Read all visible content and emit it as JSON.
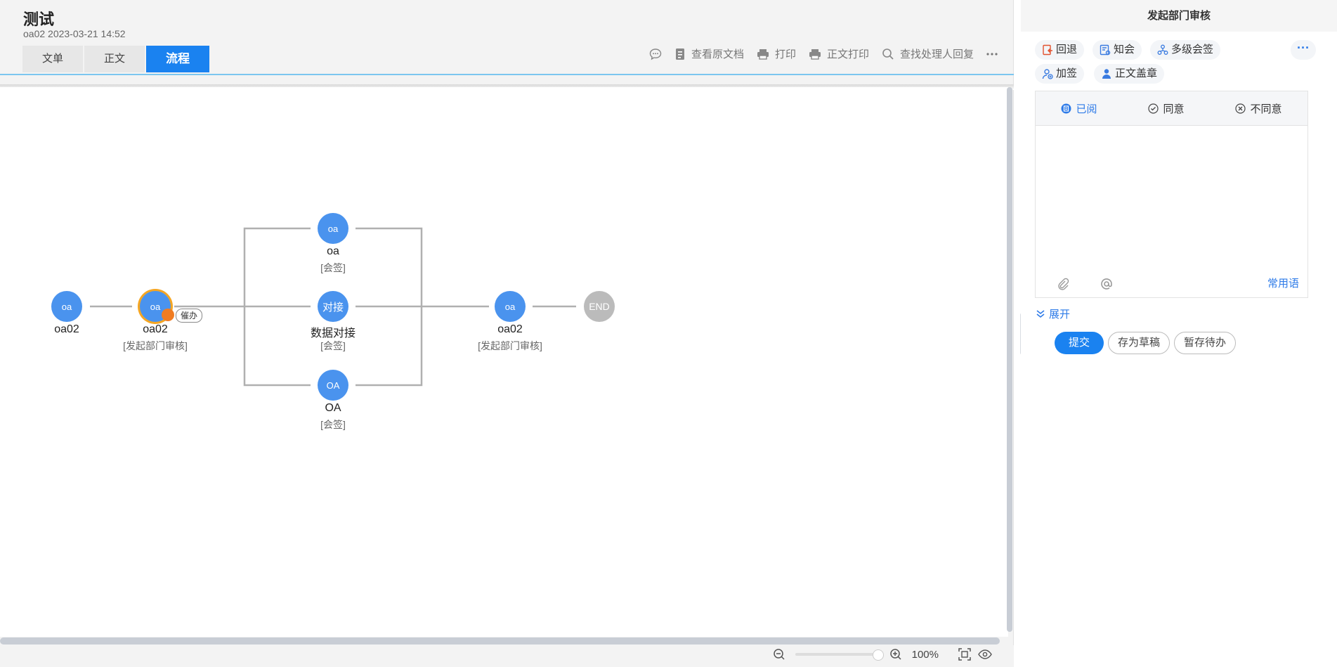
{
  "header": {
    "title": "测试",
    "meta": "oa02 2023-03-21 14:52"
  },
  "tabs": [
    {
      "label": "文单"
    },
    {
      "label": "正文"
    },
    {
      "label": "流程"
    }
  ],
  "toolbar": {
    "view_original": "查看原文档",
    "print": "打印",
    "print_body": "正文打印",
    "find_reply": "查找处理人回复",
    "more_icon": "more-dots-icon",
    "comment_icon": "comment-icon"
  },
  "flow": {
    "nodes": [
      {
        "avatar": "oa",
        "name": "oa02",
        "sub": ""
      },
      {
        "avatar": "oa",
        "name": "oa02",
        "sub": "[发起部门审核]"
      },
      {
        "avatar": "oa",
        "name": "oa",
        "sub": "[会签]"
      },
      {
        "avatar": "对接",
        "name": "数据对接",
        "sub": "[会签]"
      },
      {
        "avatar": "OA",
        "name": "OA",
        "sub": "[会签]"
      },
      {
        "avatar": "oa",
        "name": "oa02",
        "sub": "[发起部门审核]"
      },
      {
        "avatar": "END",
        "name": "",
        "sub": ""
      }
    ],
    "urge_label": "催办"
  },
  "zoom": {
    "level": "100%"
  },
  "panel": {
    "title": "发起部门审核",
    "actions": [
      "回退",
      "知会",
      "多级会签",
      "加签",
      "正文盖章"
    ],
    "opinion_tabs": [
      "已阅",
      "同意",
      "不同意"
    ],
    "common_phrase": "常用语",
    "expand": "展开",
    "submit": "提交",
    "save_draft": "存为草稿",
    "temp_save": "暂存待办"
  },
  "colors": {
    "accent": "#1a82f0",
    "node": "#4a93ee",
    "end": "#bbbbbb",
    "selected_ring": "#f5a623"
  }
}
